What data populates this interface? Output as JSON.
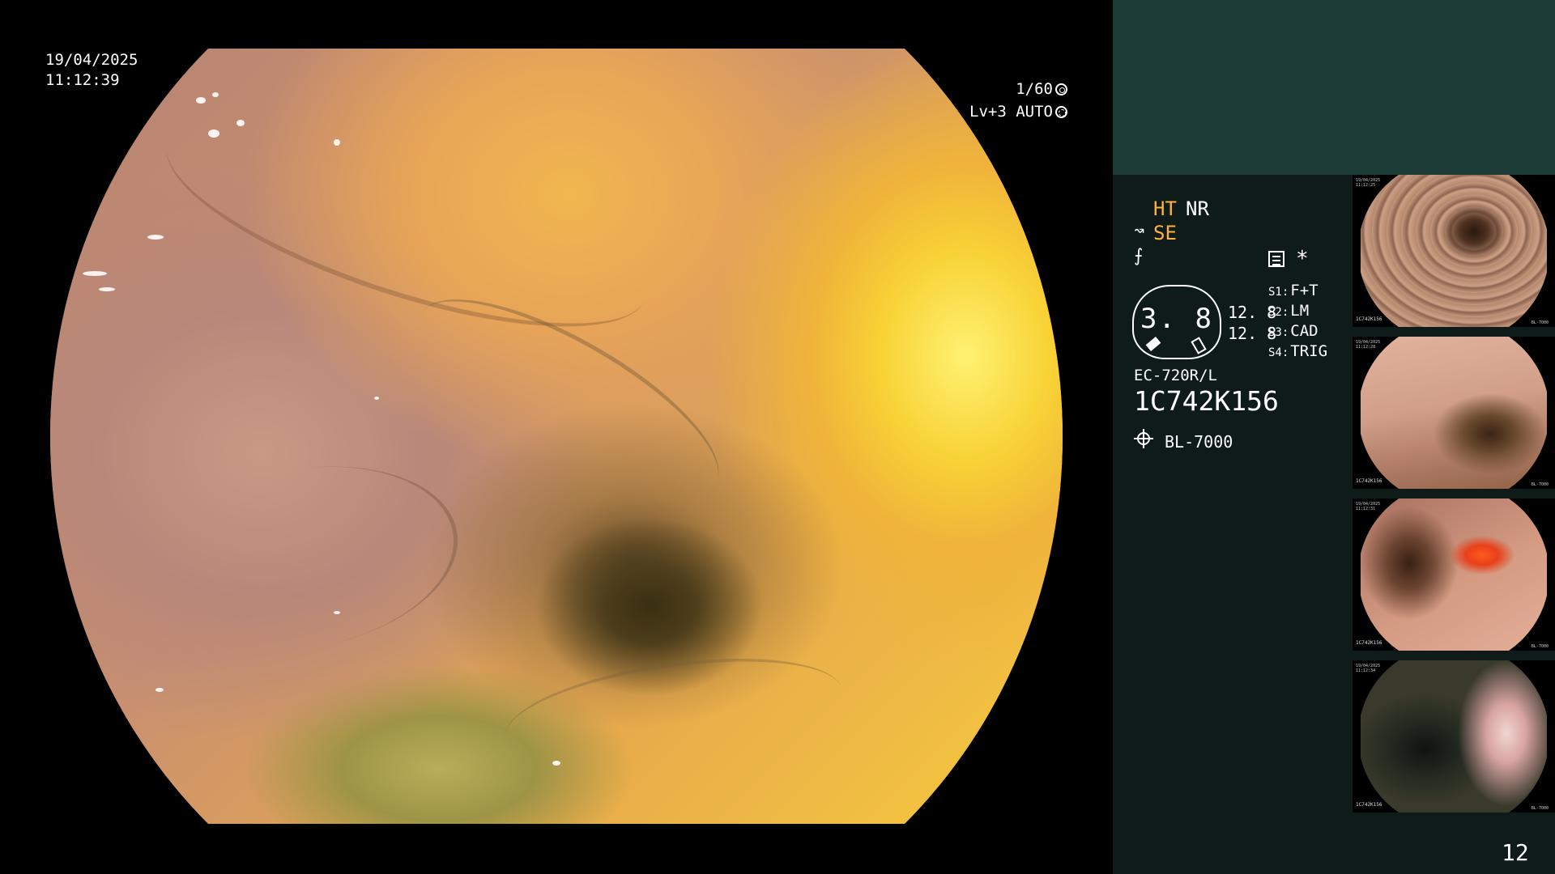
{
  "overlay": {
    "date": "19/04/2025",
    "time": "11:12:39",
    "shutter": "1/60",
    "level": "Lv+3 AUTO"
  },
  "panel": {
    "ht": "HT",
    "nr": "NR",
    "se": "SE",
    "se_icon": "↝",
    "enhance_icon": "⨍",
    "asterisk": "*",
    "gauge_value": "3. 8",
    "value_1": "12. 8",
    "value_2": "12. 8",
    "switches": [
      {
        "key": "S1:",
        "value": "F+T"
      },
      {
        "key": "S2:",
        "value": "LM"
      },
      {
        "key": "S3:",
        "value": "CAD"
      },
      {
        "key": "S4:",
        "value": "TRIG"
      }
    ],
    "model": "EC-720R/L",
    "serial": "1C742K156",
    "light_source": "BL-7000",
    "page_number": "12"
  },
  "thumbnails": [
    {
      "date": "19/04/2025",
      "time": "11:12:25",
      "serial": "1C742K156",
      "light": "BL-7000"
    },
    {
      "date": "19/04/2025",
      "time": "11:12:28",
      "serial": "1C742K156",
      "light": "BL-7000"
    },
    {
      "date": "19/04/2025",
      "time": "11:12:31",
      "serial": "1C742K156",
      "light": "BL-7000"
    },
    {
      "date": "19/04/2025",
      "time": "11:12:34",
      "serial": "1C742K156",
      "light": "BL-7000"
    }
  ],
  "colors": {
    "accent_yellow": "#ffb23c",
    "panel_top": "#1c3a36",
    "panel_main": "#0f1b19"
  }
}
